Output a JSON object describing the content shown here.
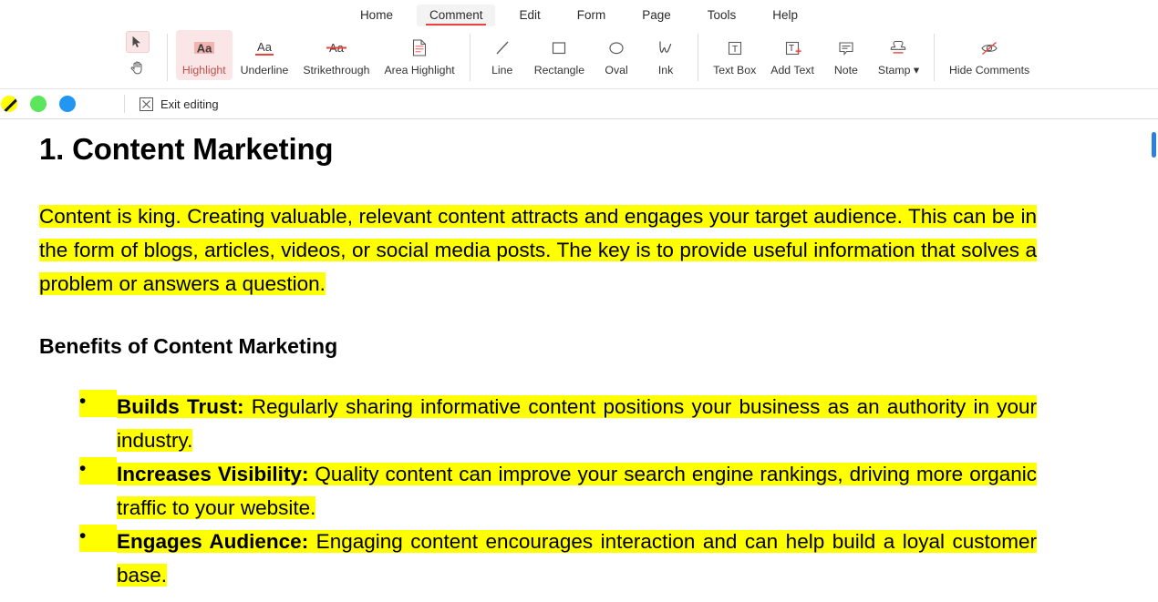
{
  "menu": {
    "items": [
      {
        "label": "Home",
        "active": false
      },
      {
        "label": "Comment",
        "active": true
      },
      {
        "label": "Edit",
        "active": false
      },
      {
        "label": "Form",
        "active": false
      },
      {
        "label": "Page",
        "active": false
      },
      {
        "label": "Tools",
        "active": false
      },
      {
        "label": "Help",
        "active": false
      }
    ]
  },
  "ribbon": {
    "select_tool_icon": "cursor-arrow-icon",
    "pan_tool_icon": "hand-pan-icon",
    "tools": [
      {
        "label": "Highlight",
        "icon": "highlight-aa-icon",
        "selected": true
      },
      {
        "label": "Underline",
        "icon": "underline-aa-icon",
        "selected": false
      },
      {
        "label": "Strikethrough",
        "icon": "strikethrough-aa-icon",
        "selected": false
      },
      {
        "label": "Area Highlight",
        "icon": "area-highlight-page-icon",
        "selected": false
      },
      {
        "label": "Line",
        "icon": "line-icon",
        "selected": false
      },
      {
        "label": "Rectangle",
        "icon": "rectangle-icon",
        "selected": false
      },
      {
        "label": "Oval",
        "icon": "oval-icon",
        "selected": false
      },
      {
        "label": "Ink",
        "icon": "ink-icon",
        "selected": false
      },
      {
        "label": "Text Box",
        "icon": "text-box-icon",
        "selected": false
      },
      {
        "label": "Add Text",
        "icon": "add-text-icon",
        "selected": false
      },
      {
        "label": "Note",
        "icon": "note-icon",
        "selected": false
      },
      {
        "label": "Stamp",
        "icon": "stamp-icon",
        "selected": false,
        "dropdown": true
      },
      {
        "label": "Hide Comments",
        "icon": "hide-comments-eye-icon",
        "selected": false
      }
    ]
  },
  "options_bar": {
    "colors": [
      {
        "name": "yellow-swatch",
        "hex": "#ffff00",
        "selected": true
      },
      {
        "name": "green-swatch",
        "hex": "#5ce65c",
        "selected": false
      },
      {
        "name": "blue-swatch",
        "hex": "#2196f3",
        "selected": false
      },
      {
        "name": "color-wheel-swatch",
        "hex": "rainbow",
        "selected": false
      }
    ],
    "exit_editing_label": "Exit editing",
    "exit_editing_icon": "close-x-icon"
  },
  "document": {
    "heading": "1. Content Marketing",
    "paragraph": "Content is king. Creating valuable, relevant content attracts and engages your target audience. This can be in the form of blogs, articles, videos, or social media posts. The key is to provide useful information that solves a problem or answers a question.",
    "subheading": "Benefits of Content Marketing",
    "bullets": [
      {
        "term": "Builds Trust:",
        "text": " Regularly sharing informative content positions your business as an authority in your industry."
      },
      {
        "term": "Increases Visibility:",
        "text": " Quality content can improve your search engine rankings, driving more organic traffic to your website."
      },
      {
        "term": "Engages Audience:",
        "text": " Engaging content encourages interaction and can help build a loyal customer base."
      }
    ],
    "highlight_color": "#ffff00"
  },
  "scrollbar": {
    "thumb_color": "#2a7fe0"
  }
}
